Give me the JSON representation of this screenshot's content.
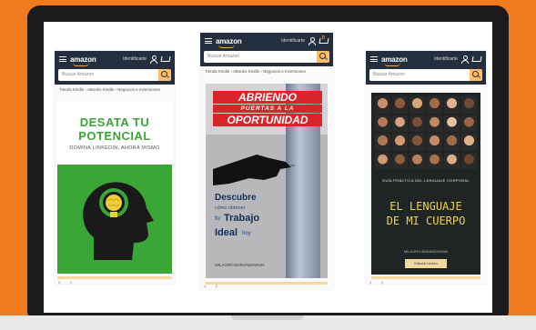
{
  "store": {
    "logo": "amazon",
    "identify_label": "Identificarte",
    "search_placeholder": "Buscar Amazon",
    "breadcrumb": "Tienda Kindle › eBooks Kindle › Negocios e Inversiones",
    "cart_count": "0"
  },
  "books": [
    {
      "title_line1": "DESATA TU",
      "title_line2": "POTENCIAL",
      "subtitle": "DOMINA LINKEDIN, AHORA MISMO"
    },
    {
      "title_line1": "ABRIENDO",
      "title_line2": "PUERTAS A LA",
      "title_line3": "OPORTUNIDAD",
      "body_descubre": "Descubre",
      "body_como": "cómo obtener",
      "body_tu": "tu",
      "body_trabajo": "Trabajo",
      "body_ideal": "Ideal",
      "body_hoy": "hoy",
      "author": "MILAGRO BARANDIARAN"
    },
    {
      "guide": "GUÍA PRÁCTICA DEL LENGUAJE CORPORAL",
      "title_line1": "EL LENGUAJE",
      "title_line2": "DE MI CUERPO",
      "author": "MILAGRO BARANDIARAN",
      "publisher": "Editorial Lectura"
    }
  ],
  "nav": {
    "prev": "‹",
    "next": "›"
  },
  "colors": {
    "background": "#f07a1e",
    "amazon_header": "#232f3e",
    "amazon_accent": "#febd69",
    "green": "#3aa635",
    "red": "#d9242b",
    "gold_title": "#f1d24a"
  },
  "face_colors": [
    "#c98f6a",
    "#8a5a3b",
    "#d9a47a",
    "#a36b4a",
    "#e2b48f",
    "#6e4a33",
    "#b57a55",
    "#d8a07c",
    "#7a5038",
    "#c48a62",
    "#e6c19c",
    "#9c6644",
    "#ae7454",
    "#d2996f",
    "#845636",
    "#c38b67",
    "#a06a4a",
    "#e0b08a",
    "#cf9a72",
    "#8b5e3f",
    "#b9805c",
    "#a7704e",
    "#dcae88",
    "#6d472f"
  ]
}
